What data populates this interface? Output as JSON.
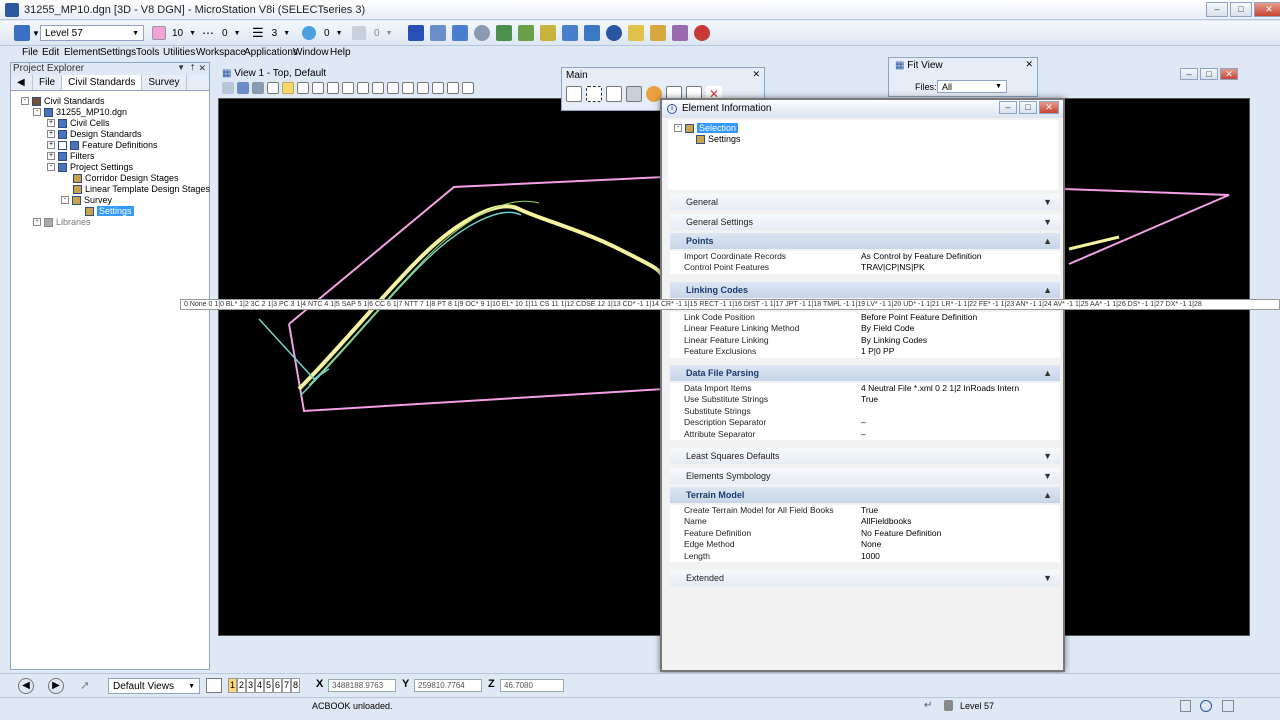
{
  "window": {
    "title": "31255_MP10.dgn [3D - V8 DGN] - MicroStation V8i (SELECTseries 3)"
  },
  "toolbar": {
    "level": "Level 57",
    "color_value": "10",
    "style_value": "0",
    "weight_value": "3",
    "transparency_value": "0",
    "priority_value": "0"
  },
  "menu": [
    "File",
    "Edit",
    "Element",
    "Settings",
    "Tools",
    "Utilities",
    "Workspace",
    "Applications",
    "Window",
    "Help"
  ],
  "project_explorer": {
    "title": "Project Explorer",
    "tabs": [
      "File",
      "Civil Standards",
      "Survey"
    ],
    "tree": [
      {
        "label": "Civil Standards",
        "level": 0
      },
      {
        "label": "31255_MP10.dgn",
        "level": 1
      },
      {
        "label": "Civil Cells",
        "level": 2
      },
      {
        "label": "Design Standards",
        "level": 2
      },
      {
        "label": "Feature Definitions",
        "level": 2
      },
      {
        "label": "Filters",
        "level": 2
      },
      {
        "label": "Project Settings",
        "level": 2
      },
      {
        "label": "Corridor Design Stages",
        "level": 3
      },
      {
        "label": "Linear Template Design Stages",
        "level": 3
      },
      {
        "label": "Survey",
        "level": 3
      },
      {
        "label": "Settings",
        "level": 4,
        "selected": true
      },
      {
        "label": "Libraries",
        "level": 0
      }
    ]
  },
  "view": {
    "title": "View 1 - Top, Default"
  },
  "main_tools": {
    "title": "Main"
  },
  "fit_view": {
    "title": "Fit View",
    "files_label": "Files:",
    "files_value": "All"
  },
  "element_info": {
    "title": "Element Information",
    "tree_root": "Selection",
    "tree_child": "Settings",
    "sections": [
      {
        "id": "general",
        "label": "General",
        "open": false
      },
      {
        "id": "general_settings",
        "label": "General Settings",
        "open": false
      },
      {
        "id": "points",
        "label": "Points",
        "open": true,
        "props": [
          {
            "key": "Import Coordinate Records",
            "value": "As Control by Feature Definition"
          },
          {
            "key": "Control Point Features",
            "value": "TRAV|CP|NS|PK"
          }
        ]
      },
      {
        "id": "linking_codes",
        "label": "Linking Codes",
        "open": true,
        "props": [
          {
            "key": "Link Code Position",
            "value": "Before Point Feature Definition"
          },
          {
            "key": "Linear Feature Linking Method",
            "value": "By Field Code"
          },
          {
            "key": "Linear Feature Linking",
            "value": "By Linking Codes"
          },
          {
            "key": "Feature Exclusions",
            "value": "1 P|0 PP"
          }
        ]
      },
      {
        "id": "data_file_parsing",
        "label": "Data File Parsing",
        "open": true,
        "props": [
          {
            "key": "Data Import Items",
            "value": "4  Neutral File *.xml 0 2        1|2  InRoads Intern"
          },
          {
            "key": "Use Substitute Strings",
            "value": "True"
          },
          {
            "key": "Substitute Strings",
            "value": ""
          },
          {
            "key": "Description Separator",
            "value": "–"
          },
          {
            "key": "Attribute Separator",
            "value": "–"
          }
        ]
      },
      {
        "id": "least_squares",
        "label": "Least Squares Defaults",
        "open": false
      },
      {
        "id": "elements_symbology",
        "label": "Elements Symbology",
        "open": false
      },
      {
        "id": "terrain_model",
        "label": "Terrain Model",
        "open": true,
        "props": [
          {
            "key": "Create Terrain Model for All Field Books",
            "value": "True"
          },
          {
            "key": "Name",
            "value": "AllFieldbooks"
          },
          {
            "key": "Feature Definition",
            "value": "No Feature Definition"
          },
          {
            "key": "Edge Method",
            "value": "None"
          },
          {
            "key": "Length",
            "value": "1000"
          }
        ]
      },
      {
        "id": "extended",
        "label": "Extended",
        "open": false
      }
    ],
    "linking_strip": "0 None 0 1|0 BL* 1|2 3C 2 1|3 PC 3 1|4 NTC 4 1|5 SAP 5 1|6 CC 6 1|7 NTT 7 1|8 PT 8 1|9 OC* 9 1|10 EL* 10 1|11 CS 11 1|12 CDSE 12 1|13 CD* -1 1|14 CR* -1 1|15 RECT -1 1|16 DIST -1 1|17 JPT -1 1|18 TMPL -1 1|19 LV* -1 1|20 UD* -1 1|21 LR* -1 1|22 FE* -1 1|23 AN* -1 1|24 AV* -1 1|25 AA* -1 1|26 DS* -1 1|27 DX* -1 1|28"
  },
  "bottom": {
    "views_label": "Default Views",
    "view_numbers": [
      "1",
      "2",
      "3",
      "4",
      "5",
      "6",
      "7",
      "8"
    ],
    "x_label": "X",
    "x_value": "3488188.9763",
    "y_label": "Y",
    "y_value": "259810.7764",
    "z_label": "Z",
    "z_value": "46.7080"
  },
  "status": {
    "message": "ACBOOK unloaded.",
    "level": "Level 57"
  }
}
